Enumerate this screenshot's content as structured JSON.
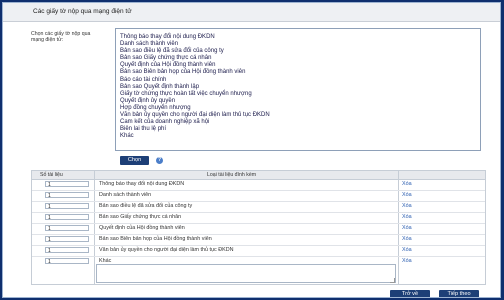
{
  "header": {
    "title": "Các giấy tờ nộp qua mạng điện tử"
  },
  "chooser": {
    "label": "Chọn các giấy tờ nộp qua mạng điện tử:",
    "options": [
      "Thông báo thay đổi nội dung ĐKDN",
      "Danh sách thành viên",
      "Bản sao điều lệ đã sửa đổi của công ty",
      "Bản sao Giấy chứng thực cá nhân",
      "Quyết định của Hội đồng thành viên",
      "Bản sao Biên bản họp của Hội đồng thành viên",
      "Báo cáo tài chính",
      "Bản sao Quyết định thành lập",
      "Giấy tờ chứng thực hoàn tất việc chuyển nhượng",
      "Quyết định ủy quyền",
      "Hợp đồng chuyển nhượng",
      "Văn bản ủy quyền cho người đại diện làm thủ tục ĐKDN",
      "Cam kết của doanh nghiệp xã hội",
      "Biên lai thu lệ phí",
      "Khác"
    ],
    "choose_label": "Chọn",
    "help_glyph": "?"
  },
  "table": {
    "col_count_header": "Số tài liệu",
    "col_type_header": "Loại tài liệu đính kèm",
    "rows": [
      {
        "qty": "1",
        "name": "Thông báo thay đổi nội dung ĐKDN",
        "delete": "Xóa"
      },
      {
        "qty": "1",
        "name": "Danh sách thành viên",
        "delete": "Xóa"
      },
      {
        "qty": "1",
        "name": "Bản sao điều lệ đã sửa đổi của công ty",
        "delete": "Xóa"
      },
      {
        "qty": "1",
        "name": "Bản sao Giấy chứng thực cá nhân",
        "delete": "Xóa"
      },
      {
        "qty": "1",
        "name": "Quyết định của Hội đồng thành viên",
        "delete": "Xóa"
      },
      {
        "qty": "1",
        "name": "Bản sao Biên bản họp của Hội đồng thành viên",
        "delete": "Xóa"
      },
      {
        "qty": "1",
        "name": "Văn bản ủy quyền cho người đại diện làm thủ tục ĐKDN",
        "delete": "Xóa"
      }
    ],
    "other_row": {
      "qty": "1",
      "name": "Khác",
      "delete": "Xóa",
      "note": ""
    }
  },
  "footer": {
    "back_label": "Trở về",
    "next_label": "Tiếp theo"
  },
  "colors": {
    "background": "#0f2f6e",
    "button": "#1d3f77",
    "link": "#2a5db0"
  }
}
